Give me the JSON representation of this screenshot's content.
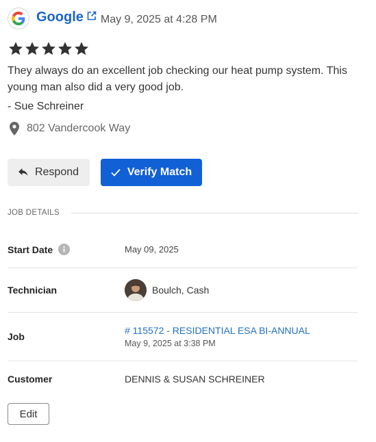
{
  "review": {
    "source": "Google",
    "date": "May 9, 2025 at 4:28 PM",
    "rating": 5,
    "text": "They always do an excellent job checking our heat pump system. This young man also did a very good job.",
    "author": "- Sue Schreiner",
    "address": "802 Vandercook Way"
  },
  "actions": {
    "respond_label": "Respond",
    "verify_label": "Verify Match",
    "edit_label": "Edit"
  },
  "job_details": {
    "section_label": "JOB DETAILS",
    "start_date_label": "Start Date",
    "start_date": "May 09, 2025",
    "technician_label": "Technician",
    "technician": "Boulch, Cash",
    "job_label": "Job",
    "job_title": "# 115572 - RESIDENTIAL ESA BI-ANNUAL",
    "job_date": "May 9, 2025 at 3:38 PM",
    "customer_label": "Customer",
    "customer": "DENNIS & SUSAN SCHREINER"
  },
  "colors": {
    "link": "#1a66c6",
    "primary_button": "#1160d6",
    "star": "#333333"
  },
  "icons": [
    "google-logo-icon",
    "external-link-icon",
    "star-icon",
    "location-pin-icon",
    "reply-icon",
    "check-icon",
    "info-icon"
  ]
}
